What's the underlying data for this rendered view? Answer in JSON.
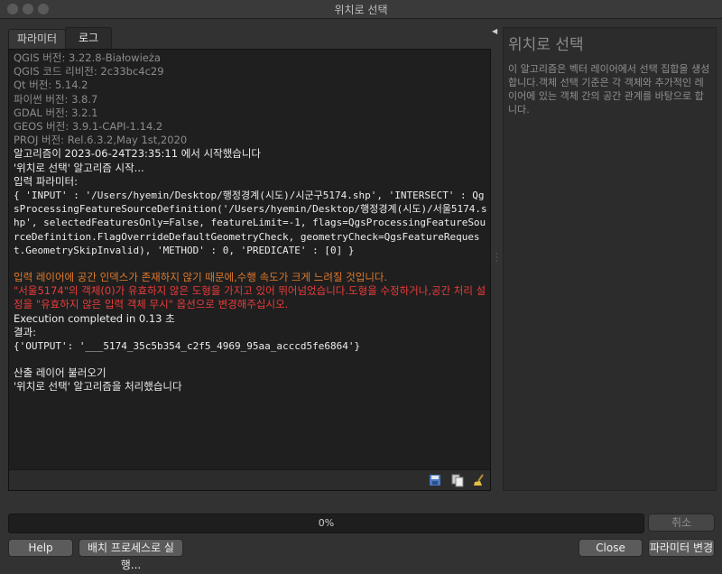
{
  "window": {
    "title": "위치로 선택"
  },
  "tabs": [
    {
      "label": "파라미터",
      "active": false
    },
    {
      "label": "로그",
      "active": true
    }
  ],
  "log": {
    "lines": [
      {
        "style": "gray",
        "text": "QGIS 버전: 3.22.8-Białowieża"
      },
      {
        "style": "gray",
        "text": "QGIS 코드 리비전: 2c33bc4c29"
      },
      {
        "style": "gray",
        "text": "Qt 버전: 5.14.2"
      },
      {
        "style": "gray",
        "text": "파이썬 버전: 3.8.7"
      },
      {
        "style": "gray",
        "text": "GDAL 버전: 3.2.1"
      },
      {
        "style": "gray",
        "text": "GEOS 버전: 3.9.1-CAPI-1.14.2"
      },
      {
        "style": "gray",
        "text": "PROJ 버전: Rel.6.3.2,May 1st,2020"
      },
      {
        "style": "white",
        "text": "알고리즘이 2023-06-24T23:35:11 에서 시작했습니다"
      },
      {
        "style": "white",
        "text": "'위치로 선택' 알고리즘 시작..."
      },
      {
        "style": "white",
        "text": "입력 파라미터:"
      },
      {
        "style": "mono",
        "text": "{ 'INPUT' : '/Users/hyemin/Desktop/행정경계(시도)/시군구5174.shp', 'INTERSECT' : QgsProcessingFeatureSourceDefinition('/Users/hyemin/Desktop/행정경계(시도)/서울5174.shp', selectedFeaturesOnly=False, featureLimit=-1, flags=QgsProcessingFeatureSourceDefinition.FlagOverrideDefaultGeometryCheck, geometryCheck=QgsFeatureRequest.GeometrySkipInvalid), 'METHOD' : 0, 'PREDICATE' : [0] }"
      },
      {
        "style": "blank",
        "text": ""
      },
      {
        "style": "orange",
        "text": "입력 레이어에 공간 인덱스가 존재하지 않기 때문에,수행 속도가 크게 느려질 것입니다."
      },
      {
        "style": "red",
        "text": "\"서울5174\"의 객체(0)가 유효하지 않은 도형을 가지고 있어 뛰어넘었습니다.도형을 수정하거나,공간 처리 설정을 \"유효하지 않은 입력 객체 무시\" 옵션으로 변경해주십시오."
      },
      {
        "style": "white",
        "text": "Execution completed in 0.13 초"
      },
      {
        "style": "white",
        "text": "결과:"
      },
      {
        "style": "mono",
        "text": "{'OUTPUT': '___5174_35c5b354_c2f5_4969_95aa_acccd5fe6864'}"
      },
      {
        "style": "blank",
        "text": ""
      },
      {
        "style": "white",
        "text": "산출 레이어 불러오기"
      },
      {
        "style": "white",
        "text": "'위치로 선택' 알고리즘을 처리했습니다"
      }
    ]
  },
  "log_toolbar": {
    "icons": [
      "save-log-icon",
      "copy-log-icon",
      "clear-log-icon"
    ]
  },
  "help": {
    "title": "위치로 선택",
    "description": "이 알고리즘은 벡터 레이어에서 선택 집합을 생성합니다.객체 선택 기준은 각 객체와 추가적인 레이어에 있는 객체 간의 공간 관계를 바탕으로 합니다."
  },
  "progress": {
    "text": "0%",
    "value": 0
  },
  "buttons": {
    "cancel": "취소",
    "help": "Help",
    "batch": "배치 프로세스로 실행...",
    "close": "Close",
    "change_params": "파라미터 변경"
  },
  "colors": {
    "background": "#323232",
    "log_background": "#1f1f1f",
    "warning": "#e07a2c",
    "error": "#ec3b3b"
  }
}
